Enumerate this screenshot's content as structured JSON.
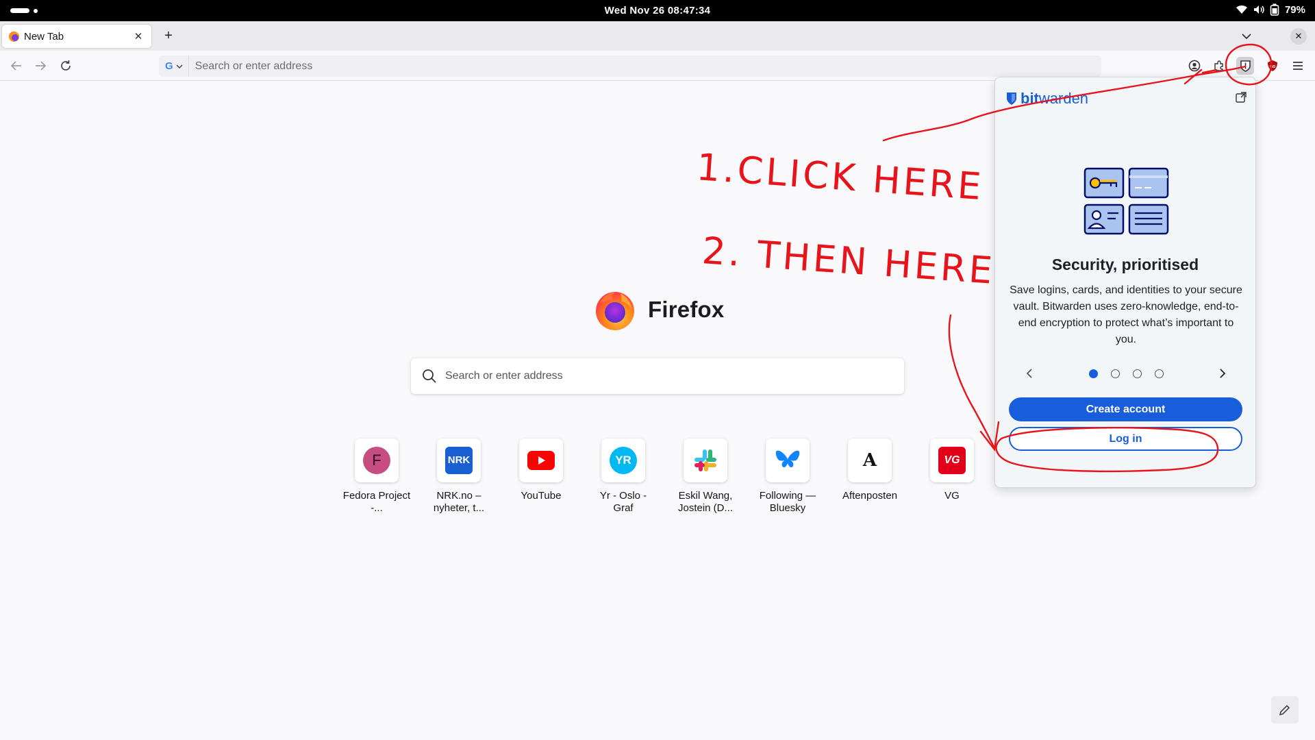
{
  "status_bar": {
    "clock": "Wed Nov 26  08:47:34",
    "battery": "79%"
  },
  "tabs": [
    {
      "title": "New Tab"
    }
  ],
  "toolbar": {
    "url_placeholder": "Search or enter address",
    "search_engine": "G"
  },
  "newtab": {
    "brand": "Firefox",
    "search_placeholder": "Search or enter address",
    "shortcuts": [
      {
        "label": "Fedora Project -...",
        "icon": "fedora-icon"
      },
      {
        "label": "NRK.no – nyheter, t...",
        "icon": "nrk-icon"
      },
      {
        "label": "YouTube",
        "icon": "youtube-icon"
      },
      {
        "label": "Yr - Oslo - Graf",
        "icon": "yr-icon"
      },
      {
        "label": "Eskil Wang, Jostein (D...",
        "icon": "slack-icon"
      },
      {
        "label": "Following — Bluesky",
        "icon": "bluesky-icon"
      },
      {
        "label": "Aftenposten",
        "icon": "aftenposten-icon"
      },
      {
        "label": "VG",
        "icon": "vg-icon"
      }
    ]
  },
  "bitwarden": {
    "logo_bold": "bit",
    "logo_light": "warden",
    "heading": "Security, prioritised",
    "body": "Save logins, cards, and identities to your secure vault. Bitwarden uses zero-knowledge, end-to-end encryption to protect what’s important to you.",
    "carousel_active": 1,
    "carousel_total": 4,
    "create_account": "Create account",
    "log_in": "Log in",
    "accent": "#175ddc"
  },
  "annotations": {
    "step1": "1.CLICK HERE",
    "step2": "2. THEN HERE",
    "color": "#e8141c"
  }
}
